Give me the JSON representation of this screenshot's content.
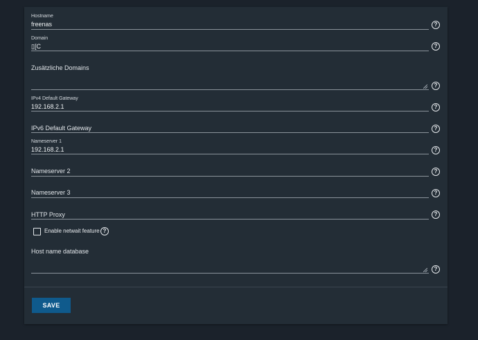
{
  "form": {
    "hostname": {
      "label": "Hostname",
      "value": "freenas"
    },
    "domain": {
      "label": "Domain",
      "value": "▯[C"
    },
    "additional_domains": {
      "placeholder": "Zusätzliche Domains"
    },
    "ipv4_gateway": {
      "label": "IPv4 Default Gateway",
      "value": "192.168.2.1"
    },
    "ipv6_gateway": {
      "placeholder": "IPv6 Default Gateway"
    },
    "nameserver1": {
      "label": "Nameserver 1",
      "value": "192.168.2.1"
    },
    "nameserver2": {
      "placeholder": "Nameserver 2"
    },
    "nameserver3": {
      "placeholder": "Nameserver 3"
    },
    "http_proxy": {
      "placeholder": "HTTP Proxy"
    },
    "netwait": {
      "label": "Enable netwait feature",
      "checked": false
    },
    "host_name_db": {
      "placeholder": "Host name database"
    },
    "help_glyph": "?",
    "save_label": "SAVE"
  },
  "colors": {
    "background": "#1b222b",
    "card": "#232d36",
    "primary_button": "#0f5a8c"
  }
}
